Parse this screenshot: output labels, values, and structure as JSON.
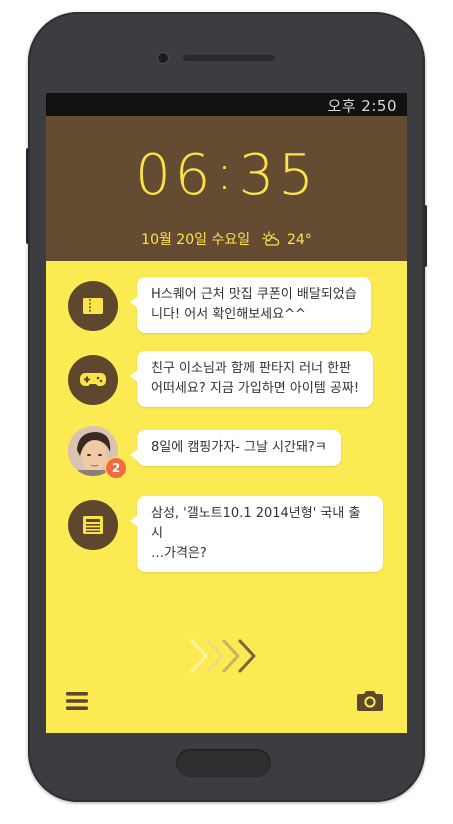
{
  "status_bar": {
    "time": "오후 2:50"
  },
  "lock_clock": {
    "hour": "06",
    "separator": ":",
    "minute": "35",
    "date": "10월 20일 수요일",
    "temperature": "24°",
    "weather_icon": "partly-cloudy-icon"
  },
  "notifications": [
    {
      "icon": "ticket-icon",
      "lines": [
        "H스퀘어 근처 맛집 쿠폰이 배달되었습",
        "니다! 어서 확인해보세요^^"
      ]
    },
    {
      "icon": "gamepad-icon",
      "lines": [
        "친구 이소님과 함께 판타지 러너 한판",
        "어떠세요? 지금 가입하면 아이템 공짜!"
      ]
    },
    {
      "icon": "contact-photo",
      "badge": "2",
      "lines": [
        "8일에 캠핑가자- 그날 시간돼?ㅋ"
      ]
    },
    {
      "icon": "news-icon",
      "lines": [
        "삼성, '갤노트10.1 2014년형' 국내 출시",
        "…가격은?"
      ]
    }
  ],
  "bottom_bar": {
    "left_icon": "menu-icon",
    "right_icon": "camera-icon",
    "center": "unlock-arrows-icon"
  },
  "colors": {
    "screen_bg": "#fcea53",
    "clock_panel": "#644c32",
    "clock_text": "#fce34a",
    "icon_circle": "#5d472d",
    "badge": "#f26a3d",
    "phone_body": "#3c3d40"
  }
}
